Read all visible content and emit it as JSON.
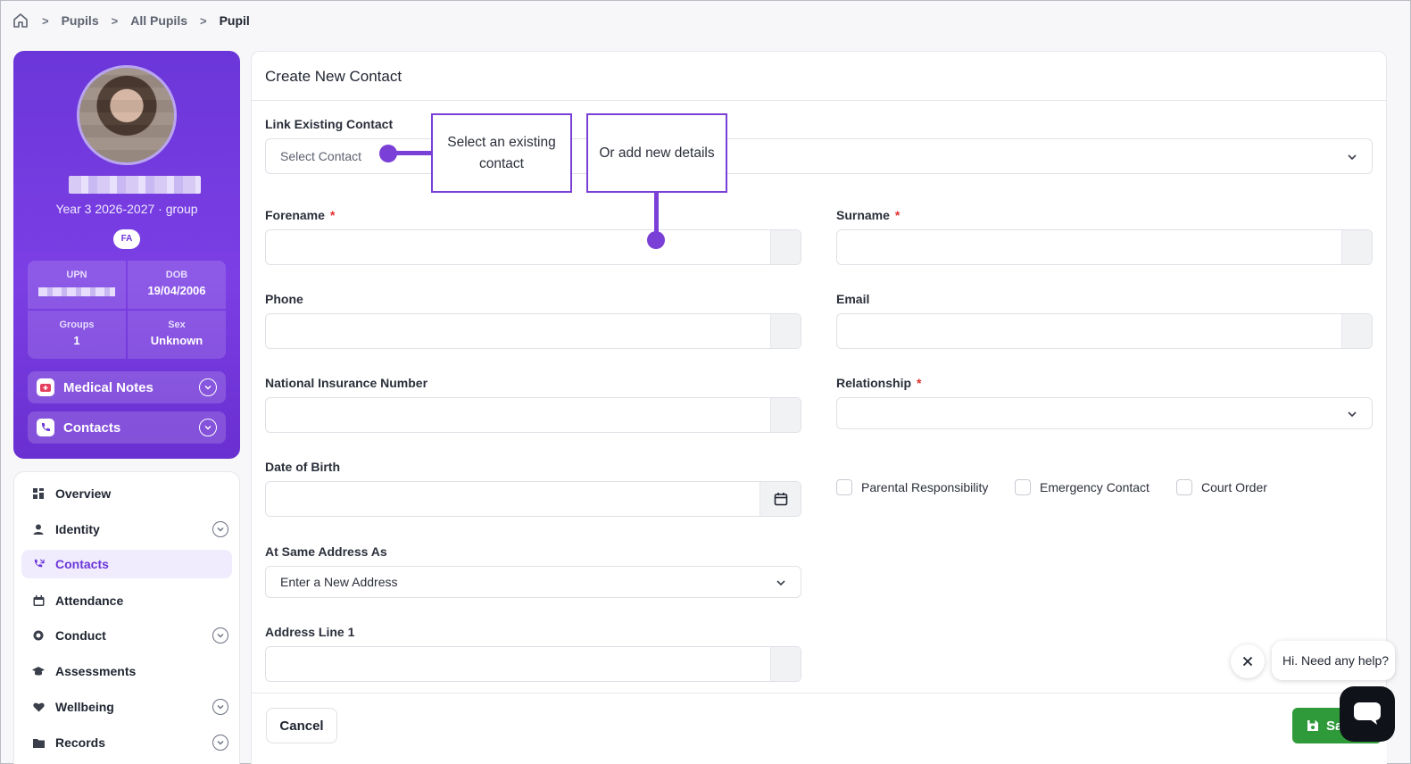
{
  "breadcrumb": {
    "items": [
      "Pupils",
      "All Pupils",
      "Pupil"
    ]
  },
  "profile": {
    "year_group": "Year 3 2026-2027 · group",
    "badge": "FA",
    "stats": [
      {
        "label": "UPN",
        "value": ""
      },
      {
        "label": "DOB",
        "value": "19/04/2006"
      },
      {
        "label": "Groups",
        "value": "1"
      },
      {
        "label": "Sex",
        "value": "Unknown"
      }
    ],
    "accordions": [
      "Medical Notes",
      "Contacts"
    ]
  },
  "nav": {
    "items": [
      {
        "label": "Overview",
        "icon": "grid-icon",
        "expandable": false,
        "active": false
      },
      {
        "label": "Identity",
        "icon": "user-icon",
        "expandable": true,
        "active": false
      },
      {
        "label": "Contacts",
        "icon": "phone-icon",
        "expandable": false,
        "active": true
      },
      {
        "label": "Attendance",
        "icon": "calendar-icon",
        "expandable": false,
        "active": false
      },
      {
        "label": "Conduct",
        "icon": "badge-icon",
        "expandable": true,
        "active": false
      },
      {
        "label": "Assessments",
        "icon": "graduation-cap-icon",
        "expandable": false,
        "active": false
      },
      {
        "label": "Wellbeing",
        "icon": "heart-icon",
        "expandable": true,
        "active": false
      },
      {
        "label": "Records",
        "icon": "folder-icon",
        "expandable": true,
        "active": false
      }
    ]
  },
  "form": {
    "title": "Create New Contact",
    "link_existing_label": "Link Existing Contact",
    "link_existing_placeholder": "Select Contact",
    "forename_label": "Forename",
    "surname_label": "Surname",
    "phone_label": "Phone",
    "email_label": "Email",
    "ni_label": "National Insurance Number",
    "relationship_label": "Relationship",
    "dob_label": "Date of Birth",
    "same_address_label": "At Same Address As",
    "same_address_value": "Enter a New Address",
    "address_line1_label": "Address Line 1",
    "checkboxes": [
      "Parental Responsibility",
      "Emergency Contact",
      "Court Order"
    ],
    "required_marker": "*"
  },
  "tour": {
    "callout1": "Select an existing contact",
    "callout2": "Or add new details"
  },
  "footer": {
    "cancel_label": "Cancel",
    "save_label": "Sa"
  },
  "help": {
    "message": "Hi. Need any help?"
  },
  "colors": {
    "accent": "#7a3fd6",
    "profile_bg": "#6b36d9",
    "save": "#2f9a3a",
    "required": "#e0312f"
  }
}
